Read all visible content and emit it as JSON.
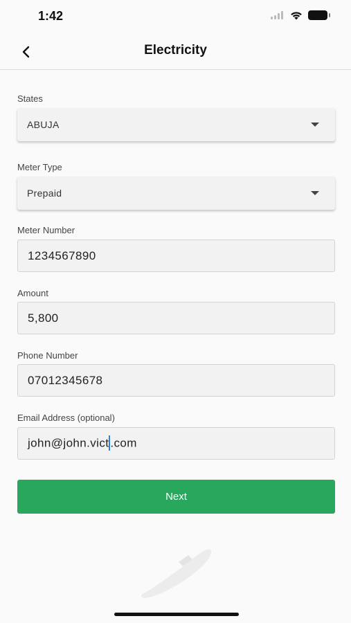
{
  "status_bar": {
    "time": "1:42"
  },
  "header": {
    "title": "Electricity"
  },
  "form": {
    "states": {
      "label": "States",
      "value": "ABUJA"
    },
    "meter_type": {
      "label": "Meter Type",
      "value": "Prepaid"
    },
    "meter_number": {
      "label": "Meter Number",
      "value": "1234567890"
    },
    "amount": {
      "label": "Amount",
      "value": "5,800"
    },
    "phone_number": {
      "label": "Phone Number",
      "value": "07012345678"
    },
    "email": {
      "label": "Email Address (optional)",
      "value_before_cursor": "john@john.vict",
      "value_after_cursor": ".com"
    }
  },
  "actions": {
    "next_label": "Next"
  },
  "colors": {
    "primary": "#27a85d",
    "background": "#fafafa",
    "field": "#f2f2f2",
    "cursor": "#2f7fe0"
  },
  "icons": [
    "back-chevron-icon",
    "signal-icon",
    "wifi-icon",
    "battery-icon",
    "dropdown-caret-icon"
  ]
}
